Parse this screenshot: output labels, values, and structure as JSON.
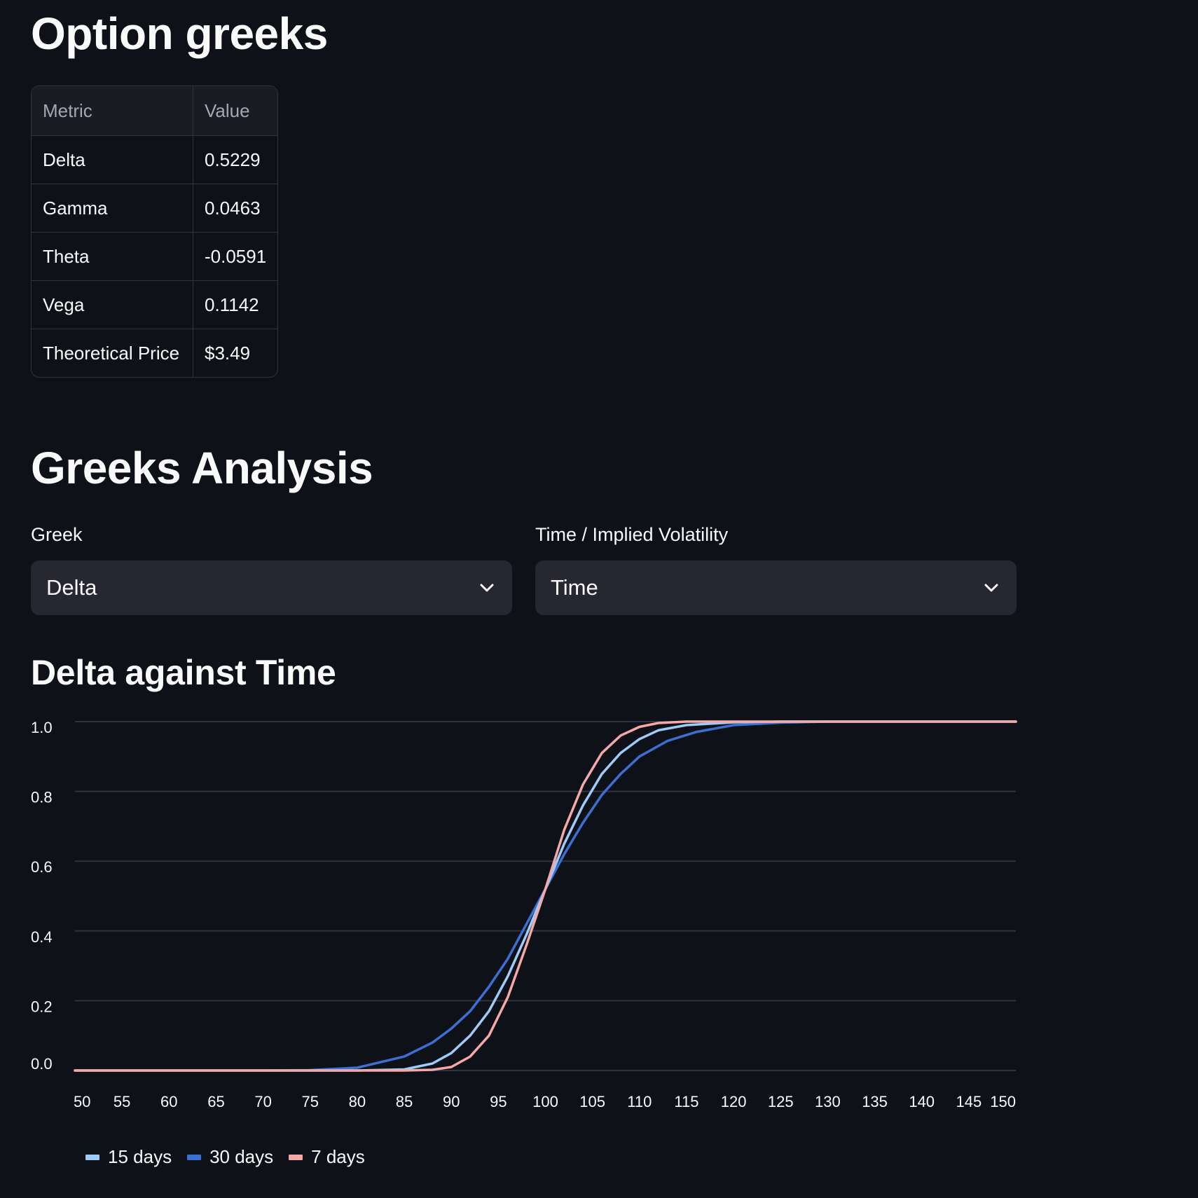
{
  "page": {
    "title": "Option greeks",
    "section_title": "Greeks Analysis",
    "chart_title": "Delta against Time"
  },
  "metrics_table": {
    "headers": [
      "Metric",
      "Value"
    ],
    "rows": [
      {
        "metric": "Delta",
        "value": "0.5229"
      },
      {
        "metric": "Gamma",
        "value": "0.0463"
      },
      {
        "metric": "Theta",
        "value": "-0.0591"
      },
      {
        "metric": "Vega",
        "value": "0.1142"
      },
      {
        "metric": "Theoretical Price",
        "value": "$3.49"
      }
    ]
  },
  "controls": {
    "greek": {
      "label": "Greek",
      "value": "Delta"
    },
    "mode": {
      "label": "Time / Implied Volatility",
      "value": "Time"
    }
  },
  "colors": {
    "background": "#0e1117",
    "series_15": "#9ecbf7",
    "series_30": "#3b6fd4",
    "series_7": "#f4a9a8",
    "grid": "#31333f"
  },
  "chart_data": {
    "type": "line",
    "title": "Delta against Time",
    "xlabel": "",
    "ylabel": "",
    "xlim": [
      50,
      150
    ],
    "ylim": [
      0,
      1
    ],
    "x_ticks": [
      50,
      55,
      60,
      65,
      70,
      75,
      80,
      85,
      90,
      95,
      100,
      105,
      110,
      115,
      120,
      125,
      130,
      135,
      140,
      145,
      150
    ],
    "y_ticks": [
      "0.0",
      "0.2",
      "0.4",
      "0.6",
      "0.8",
      "1.0"
    ],
    "grid": true,
    "legend_position": "bottom-left",
    "series": [
      {
        "name": "15 days",
        "color": "#9ecbf7",
        "x": [
          50,
          80,
          85,
          88,
          90,
          92,
          94,
          96,
          98,
          100,
          102,
          104,
          106,
          108,
          110,
          112,
          115,
          120,
          125,
          150
        ],
        "y": [
          0.0,
          0.0,
          0.003,
          0.02,
          0.05,
          0.1,
          0.17,
          0.27,
          0.39,
          0.52,
          0.65,
          0.76,
          0.85,
          0.91,
          0.95,
          0.975,
          0.99,
          0.998,
          1.0,
          1.0
        ]
      },
      {
        "name": "30 days",
        "color": "#3b6fd4",
        "x": [
          50,
          70,
          75,
          80,
          85,
          88,
          90,
          92,
          94,
          96,
          98,
          100,
          102,
          104,
          106,
          108,
          110,
          113,
          116,
          120,
          125,
          130,
          150
        ],
        "y": [
          0.0,
          0.0,
          0.001,
          0.008,
          0.04,
          0.08,
          0.12,
          0.17,
          0.24,
          0.32,
          0.42,
          0.52,
          0.62,
          0.71,
          0.79,
          0.85,
          0.9,
          0.945,
          0.97,
          0.99,
          0.997,
          1.0,
          1.0
        ]
      },
      {
        "name": "7 days",
        "color": "#f4a9a8",
        "x": [
          50,
          85,
          88,
          90,
          92,
          94,
          96,
          98,
          100,
          102,
          104,
          106,
          108,
          110,
          112,
          115,
          150
        ],
        "y": [
          0.0,
          0.0,
          0.002,
          0.01,
          0.04,
          0.1,
          0.21,
          0.36,
          0.52,
          0.69,
          0.82,
          0.91,
          0.96,
          0.985,
          0.996,
          1.0,
          1.0
        ]
      }
    ]
  }
}
